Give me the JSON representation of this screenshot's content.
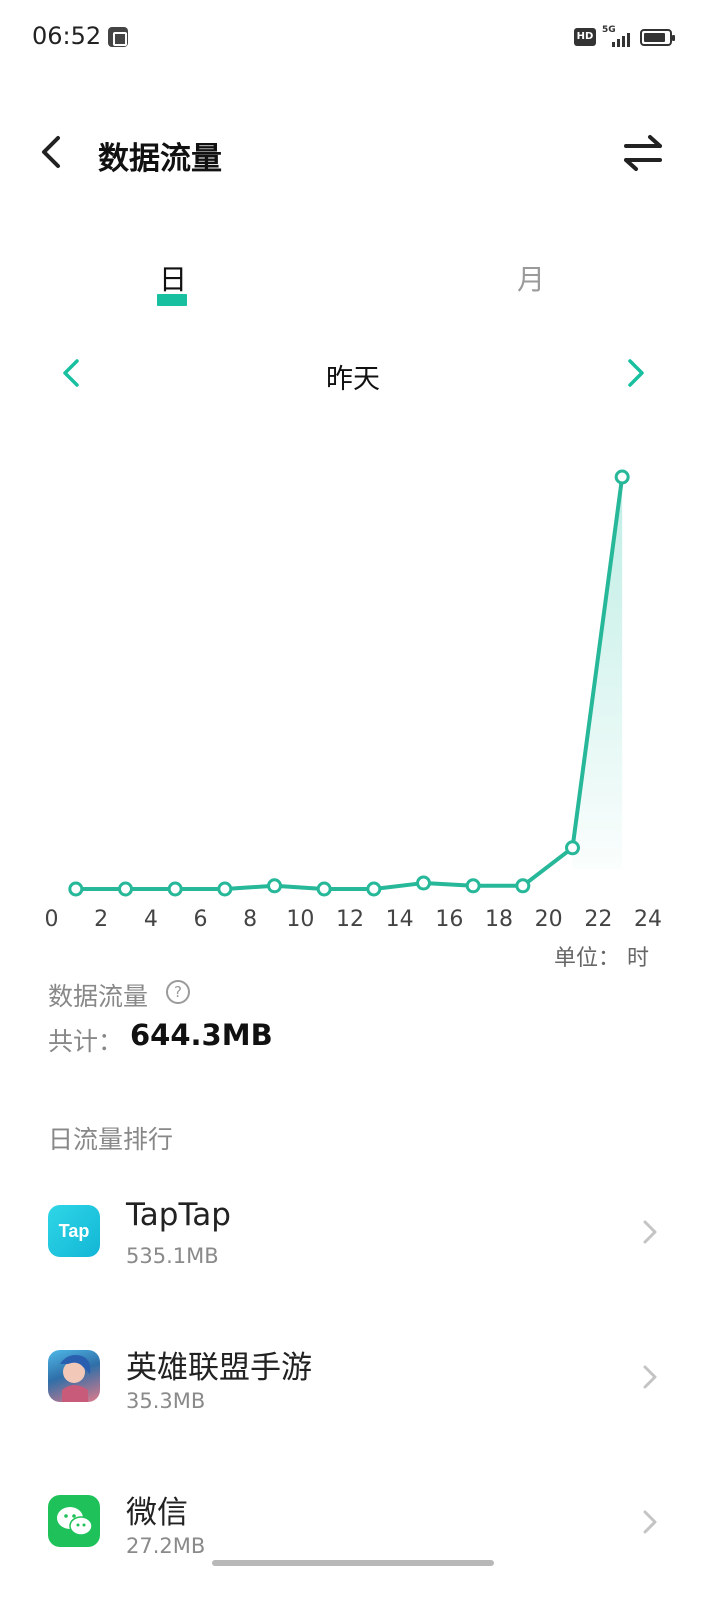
{
  "status_bar": {
    "time": "06:52",
    "hd_label": "HD",
    "network_label": "5G",
    "icons": [
      "notification-icon",
      "hd-icon",
      "signal-icon",
      "battery-icon"
    ]
  },
  "header": {
    "title": "数据流量",
    "back_icon": "back-arrow-icon",
    "switch_icon": "swap-arrows-icon"
  },
  "tabs": [
    {
      "label": "日",
      "active": true
    },
    {
      "label": "月",
      "active": false
    }
  ],
  "date_nav": {
    "label": "昨天",
    "prev_icon": "chevron-left-icon",
    "next_icon": "chevron-right-icon"
  },
  "colors": {
    "accent": "#19c0a0",
    "line": "#26b899",
    "muted_text": "#888888"
  },
  "chart_data": {
    "type": "line",
    "x_ticks": [
      "0",
      "2",
      "4",
      "6",
      "8",
      "10",
      "12",
      "14",
      "16",
      "18",
      "20",
      "22",
      "24"
    ],
    "xlim": [
      0,
      24
    ],
    "points": [
      {
        "x": 1,
        "y": 0
      },
      {
        "x": 3,
        "y": 0
      },
      {
        "x": 5,
        "y": 0
      },
      {
        "x": 7,
        "y": 0
      },
      {
        "x": 9,
        "y": 0.7
      },
      {
        "x": 11,
        "y": 0
      },
      {
        "x": 13,
        "y": 0
      },
      {
        "x": 15,
        "y": 1.3
      },
      {
        "x": 17,
        "y": 0.7
      },
      {
        "x": 19,
        "y": 0.7
      },
      {
        "x": 21,
        "y": 9
      },
      {
        "x": 23,
        "y": 90
      }
    ],
    "ylim": [
      0,
      90
    ],
    "unit_label": "单位： 时",
    "grid": false,
    "area_fill_last_segment": true
  },
  "summary": {
    "title": "数据流量",
    "help_icon": "help-circle-icon",
    "total_label": "共计：",
    "total_value": "644.3MB"
  },
  "ranking": {
    "title": "日流量排行",
    "apps": [
      {
        "name": "TapTap",
        "size": "535.1MB",
        "icon": "taptap-app-icon",
        "icon_text": "Tap"
      },
      {
        "name": "英雄联盟手游",
        "size": "35.3MB",
        "icon": "league-of-legends-app-icon"
      },
      {
        "name": "微信",
        "size": "27.2MB",
        "icon": "wechat-app-icon"
      }
    ]
  }
}
